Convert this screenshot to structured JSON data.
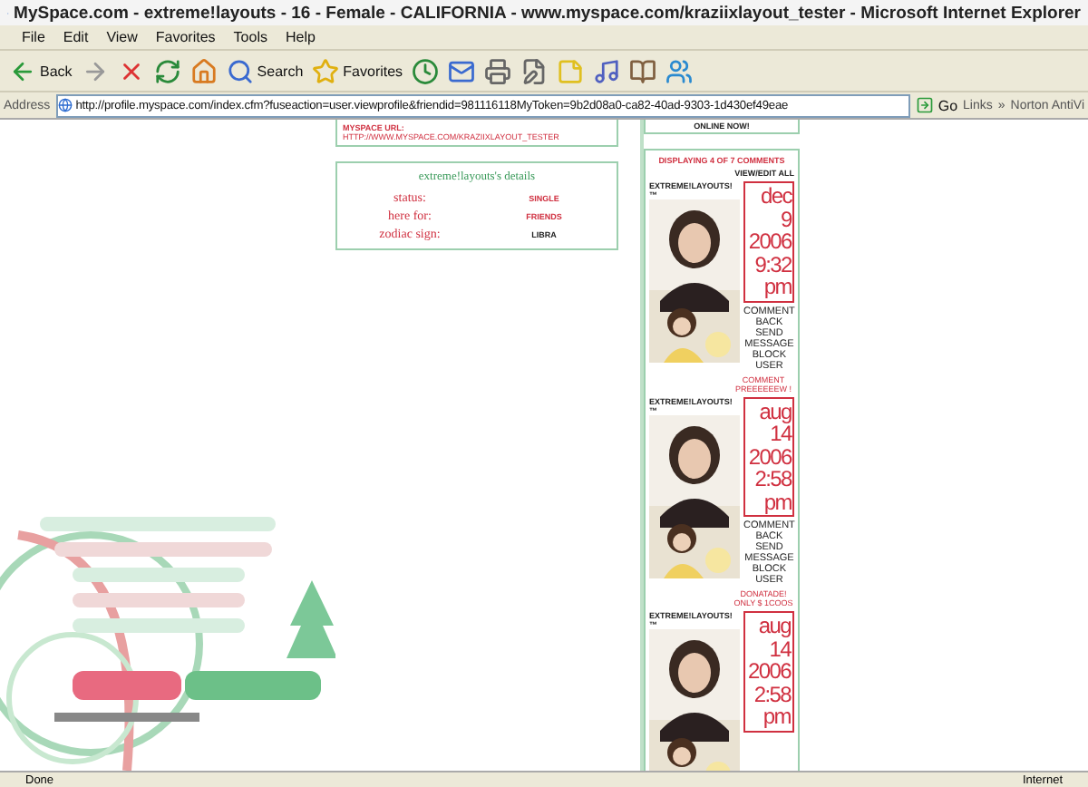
{
  "window": {
    "title": "MySpace.com - extreme!layouts - 16 - Female - CALIFORNIA - www.myspace.com/kraziixlayout_tester - Microsoft Internet Explorer"
  },
  "menu": [
    "File",
    "Edit",
    "View",
    "Favorites",
    "Tools",
    "Help"
  ],
  "toolbar": [
    {
      "kind": "back",
      "label": "Back"
    },
    {
      "kind": "forward"
    },
    {
      "kind": "stop"
    },
    {
      "kind": "refresh"
    },
    {
      "kind": "home"
    },
    {
      "kind": "search",
      "label": "Search"
    },
    {
      "kind": "favorites",
      "label": "Favorites"
    },
    {
      "kind": "history"
    },
    {
      "kind": "mail"
    },
    {
      "kind": "print"
    },
    {
      "kind": "edit"
    },
    {
      "kind": "note"
    },
    {
      "kind": "media"
    },
    {
      "kind": "research"
    },
    {
      "kind": "people"
    }
  ],
  "address": {
    "label": "Address",
    "url": "http://profile.myspace.com/index.cfm?fuseaction=user.viewprofile&friendid=981116118MyToken=9b2d08a0-ca82-40ad-9303-1d430ef49eae",
    "go": "Go",
    "links": "Links",
    "more": "»",
    "norton": "Norton AntiVi"
  },
  "profile": {
    "url_heading": "MYSPACE URL:",
    "url": "HTTP://WWW.MYSPACE.COM/KRAZIIXLAYOUT_TESTER",
    "details_title": "extreme!layouts's details",
    "details": [
      {
        "label": "status:",
        "value": "SINGLE",
        "color": "#d03040"
      },
      {
        "label": "here for:",
        "value": "FRIENDS",
        "color": "#d03040"
      },
      {
        "label": "zodiac sign:",
        "value": "LIBRA",
        "color": "#222222"
      }
    ]
  },
  "online": "ONLINE NOW!",
  "comments": {
    "heading": "DISPLAYING 4 OF 7 COMMENTS",
    "view_all": "VIEW/EDIT ALL",
    "items": [
      {
        "author": "EXTREME!LAYOUTS!™",
        "date": [
          "dec 9",
          "2006",
          "9:32",
          "pm"
        ],
        "actions": [
          "COMMENT",
          "BACK",
          "SEND",
          "MESSAGE",
          "BLOCK",
          "USER"
        ],
        "message": "COMMENT PREEEEEEW !"
      },
      {
        "author": "EXTREME!LAYOUTS!™",
        "date": [
          "aug",
          "14",
          "2006",
          "2:58",
          "pm"
        ],
        "actions": [
          "COMMENT",
          "BACK",
          "SEND",
          "MESSAGE",
          "BLOCK",
          "USER"
        ],
        "message": "DONATADE! ONLY $ 1COOS"
      },
      {
        "author": "EXTREME!LAYOUTS!™",
        "date": [
          "aug",
          "14",
          "2006",
          "2:58",
          "pm"
        ]
      }
    ]
  },
  "status": {
    "text": "Done",
    "zone": "Internet"
  }
}
